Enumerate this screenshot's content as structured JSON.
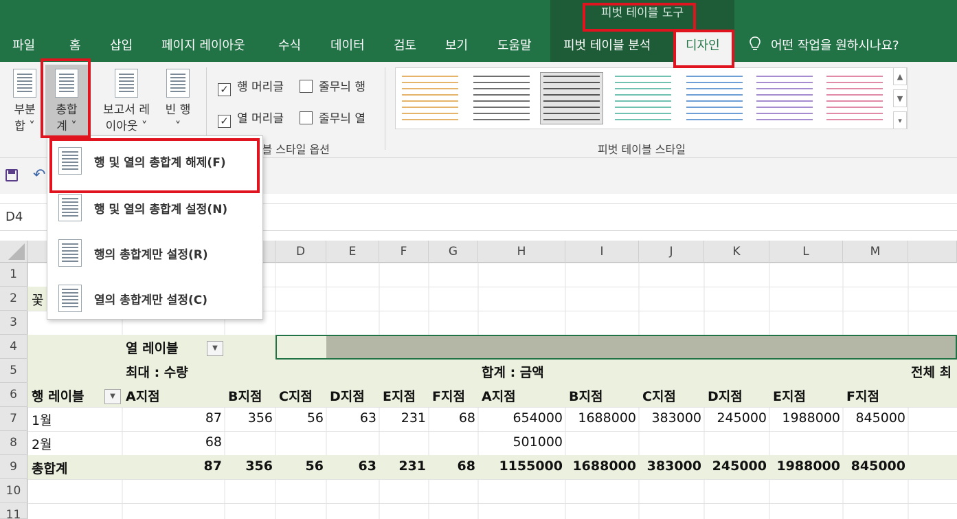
{
  "context_tab_title": "피벗 테이블 도구",
  "tabs": [
    "파일",
    "홈",
    "삽입",
    "페이지 레이아웃",
    "수식",
    "데이터",
    "검토",
    "보기",
    "도움말",
    "피벗 테이블 분석"
  ],
  "active_tab": "디자인",
  "tell_me": "어떤 작업을 원하시나요?",
  "ribbon": {
    "subtotals_l1": "부분",
    "subtotals_l2": "합 ˅",
    "grand_totals_l1": "총합",
    "grand_totals_l2": "계 ˅",
    "report_layout_l1": "보고서 레",
    "report_layout_l2": "이아웃 ˅",
    "blank_rows_l1": "빈 행",
    "blank_rows_l2": "˅",
    "row_headers": "행 머리글",
    "col_headers": "열 머리글",
    "banded_rows": "줄무늬 행",
    "banded_cols": "줄무늬 열",
    "style_options_label": "테이블 스타일 옵션",
    "styles_label": "피벗 테이블 스타일"
  },
  "name_box": "D4",
  "menu": [
    {
      "label": "행 및 열의 총합계 해제(F)"
    },
    {
      "label": "행 및 열의 총합계 설정(N)"
    },
    {
      "label": "행의 총합계만 설정(R)"
    },
    {
      "label": "열의 총합계만 설정(C)"
    }
  ],
  "columns": [
    "D",
    "E",
    "F",
    "G",
    "H",
    "I",
    "J",
    "K",
    "L",
    "M"
  ],
  "rows": [
    "1",
    "2",
    "3",
    "4",
    "5",
    "6",
    "7",
    "8",
    "9",
    "10",
    "11"
  ],
  "sheet": {
    "a2": "꽃",
    "col_labels": "열 레이블",
    "max_qty": "최대 : 수량",
    "sum_amount": "합계 : 금액",
    "total_max": "전체 최",
    "row_labels": "행 레이블",
    "headers_qty": [
      "A지점",
      "B지점",
      "C지점",
      "D지점",
      "E지점",
      "F지점"
    ],
    "headers_amt": [
      "A지점",
      "B지점",
      "C지점",
      "D지점",
      "E지점",
      "F지점"
    ],
    "r7_label": "1월",
    "r7": [
      "87",
      "356",
      "56",
      "63",
      "231",
      "68",
      "654000",
      "1688000",
      "383000",
      "245000",
      "1988000",
      "845000"
    ],
    "r8_label": "2월",
    "r8": [
      "68",
      "",
      "",
      "",
      "",
      "",
      "501000",
      "",
      "",
      "",
      "",
      ""
    ],
    "r9_label": "총합계",
    "r9": [
      "87",
      "356",
      "56",
      "63",
      "231",
      "68",
      "1155000",
      "1688000",
      "383000",
      "245000",
      "1988000",
      "845000"
    ]
  }
}
